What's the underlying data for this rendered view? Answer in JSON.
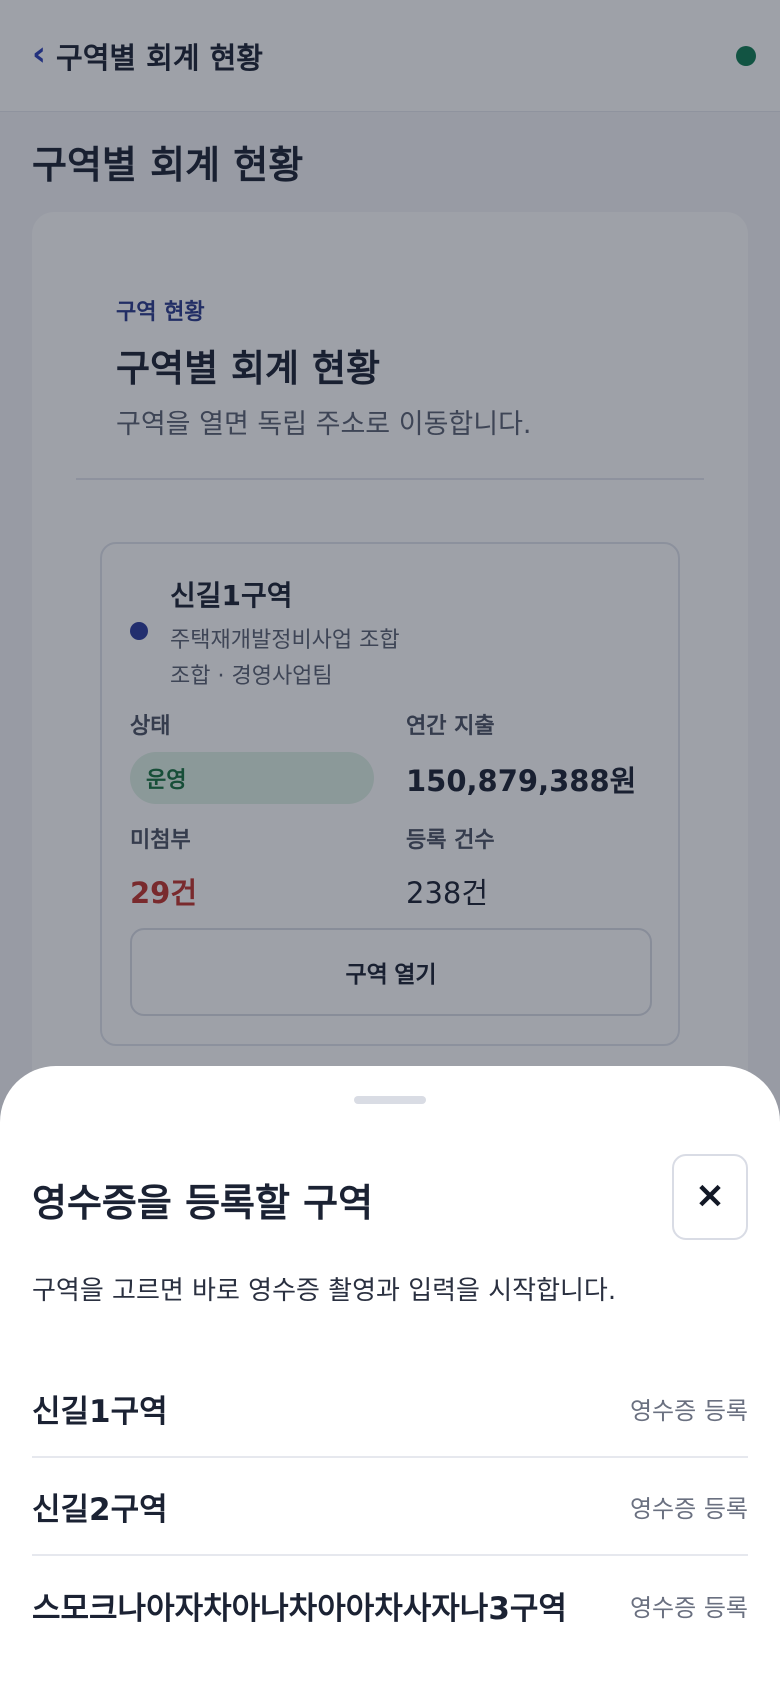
{
  "topbar": {
    "back_icon": "‹",
    "title": "구역별 회계 현황",
    "status_color": "#0f7a52"
  },
  "page": {
    "title": "구역별 회계 현황"
  },
  "overview": {
    "eyebrow": "구역 현황",
    "title": "구역별 회계 현황",
    "description": "구역을 열면 독립 주소로 이동합니다."
  },
  "district_card": {
    "name": "신길1구역",
    "type": "주택재개발정비사업 조합",
    "owner": "조합 · 경영사업팀",
    "status_label": "상태",
    "status_value": "운영",
    "spend_label": "연간 지출",
    "spend_value": "150,879,388원",
    "missing_label": "미첨부",
    "missing_value": "29건",
    "count_label": "등록 건수",
    "count_value": "238건",
    "open_button": "구역 열기"
  },
  "sheet": {
    "title": "영수증을 등록할 구역",
    "close_icon": "✕",
    "description": "구역을 고르면 바로 영수증 촬영과 입력을 시작합니다.",
    "rows": [
      {
        "name": "신길1구역",
        "action": "영수증 등록"
      },
      {
        "name": "신길2구역",
        "action": "영수증 등록"
      },
      {
        "name": "스모크나아자차아나차아아차사자나3구역",
        "action": "영수증 등록"
      }
    ]
  }
}
